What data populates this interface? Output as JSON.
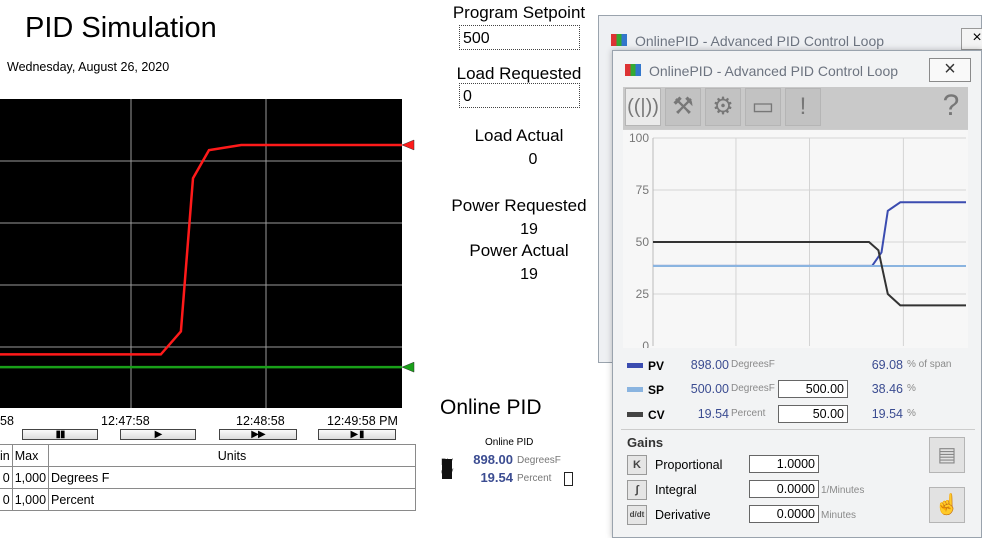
{
  "app": {
    "title": "PID Simulation",
    "date": "Wednesday, August 26, 2020"
  },
  "setpoints": {
    "program_setpoint_label": "Program Setpoint",
    "program_setpoint_value": "500",
    "load_requested_label": "Load Requested",
    "load_requested_value": "0",
    "load_actual_label": "Load Actual",
    "load_actual_value": "0",
    "power_requested_label": "Power Requested",
    "power_requested_value": "19",
    "power_actual_label": "Power Actual",
    "power_actual_value": "19"
  },
  "trend": {
    "time_ticks": [
      "58",
      "12:47:58",
      "12:48:58",
      "12:49:58 PM"
    ],
    "controls": [
      "▮▮",
      "▶",
      "▶▶",
      "▶ ▮"
    ],
    "series": [
      {
        "name": "red",
        "color": "#ff1a1a",
        "points": [
          [
            0,
            21
          ],
          [
            0.4,
            21
          ],
          [
            0.45,
            30
          ],
          [
            0.48,
            90
          ],
          [
            0.52,
            101
          ],
          [
            0.6,
            103
          ],
          [
            1,
            103
          ]
        ]
      },
      {
        "name": "green",
        "color": "#19a019",
        "points": [
          [
            0,
            16
          ],
          [
            1,
            16
          ]
        ]
      }
    ],
    "table": {
      "headers": [
        "in",
        "Max",
        "Units"
      ],
      "rows": [
        {
          "min": "0",
          "max": "1,000",
          "units": "Degrees F"
        },
        {
          "min": "0",
          "max": "1,000",
          "units": "Percent"
        }
      ]
    }
  },
  "online_pid": {
    "heading": "Online PID",
    "mini_title": "Online PID",
    "pv_label": "PV",
    "cv_label": "CV",
    "pv_value": "898.00",
    "pv_unit": "DegreesF",
    "cv_value": "19.54",
    "cv_unit": "Percent"
  },
  "faceplate": {
    "back_title": "OnlinePID - Advanced PID Control Loop",
    "title": "OnlinePID - Advanced PID Control Loop",
    "close_label": "×",
    "tabs": [
      "trend-icon",
      "wrench-icon",
      "gear-icon",
      "window-icon",
      "alarm-icon",
      "help-icon"
    ],
    "chart_data": {
      "type": "line",
      "ylim": [
        0,
        100
      ],
      "y_ticks": [
        "100",
        "75",
        "50",
        "25",
        "0"
      ],
      "series": [
        {
          "name": "PV",
          "color": "#3b4cb0",
          "values": [
            [
              0,
              38.5
            ],
            [
              0.7,
              38.5
            ],
            [
              0.73,
              45
            ],
            [
              0.75,
              65
            ],
            [
              0.79,
              69.1
            ],
            [
              1,
              69.1
            ]
          ]
        },
        {
          "name": "SP",
          "color": "#8ab4e0",
          "values": [
            [
              0,
              38.46
            ],
            [
              1,
              38.46
            ]
          ]
        },
        {
          "name": "CV",
          "color": "#333333",
          "values": [
            [
              0,
              50
            ],
            [
              0.69,
              50
            ],
            [
              0.72,
              46
            ],
            [
              0.75,
              25
            ],
            [
              0.79,
              19.5
            ],
            [
              1,
              19.5
            ]
          ]
        }
      ]
    },
    "rows": [
      {
        "name": "PV",
        "color": "#3b4cb0",
        "value": "898.00",
        "unit": "DegreesF",
        "input": "",
        "pct": "69.08",
        "pct_unit": "% of span"
      },
      {
        "name": "SP",
        "color": "#8ab4e0",
        "value": "500.00",
        "unit": "DegreesF",
        "input": "500.00",
        "pct": "38.46",
        "pct_unit": "%"
      },
      {
        "name": "CV",
        "color": "#444444",
        "value": "19.54",
        "unit": "Percent",
        "input": "50.00",
        "pct": "19.54",
        "pct_unit": "%"
      }
    ],
    "gains_label": "Gains",
    "gains": [
      {
        "icon": "K",
        "label": "Proportional",
        "value": "1.0000",
        "unit": ""
      },
      {
        "icon": "∫",
        "label": "Integral",
        "value": "0.0000",
        "unit": "1/Minutes"
      },
      {
        "icon": "d/dt",
        "label": "Derivative",
        "value": "0.0000",
        "unit": "Minutes"
      }
    ]
  }
}
